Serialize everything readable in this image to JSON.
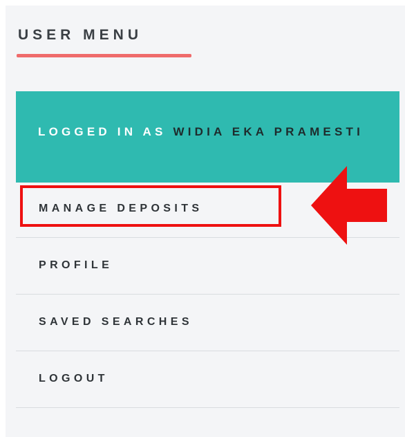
{
  "menu": {
    "title": "USER MENU",
    "logged_in": {
      "prefix": "LOGGED IN AS",
      "name": "WIDIA EKA PRAMESTI"
    },
    "items": [
      {
        "label": "MANAGE DEPOSITS"
      },
      {
        "label": "PROFILE"
      },
      {
        "label": "SAVED SEARCHES"
      },
      {
        "label": "LOGOUT"
      }
    ]
  },
  "colors": {
    "accent_teal": "#2fbab0",
    "title_underline": "#ef6b6b",
    "annotation_red": "#ee1111",
    "panel_background": "#f4f5f7"
  },
  "annotation": {
    "highlighted_item": "MANAGE DEPOSITS",
    "arrow_icon": "left-arrow-icon"
  }
}
